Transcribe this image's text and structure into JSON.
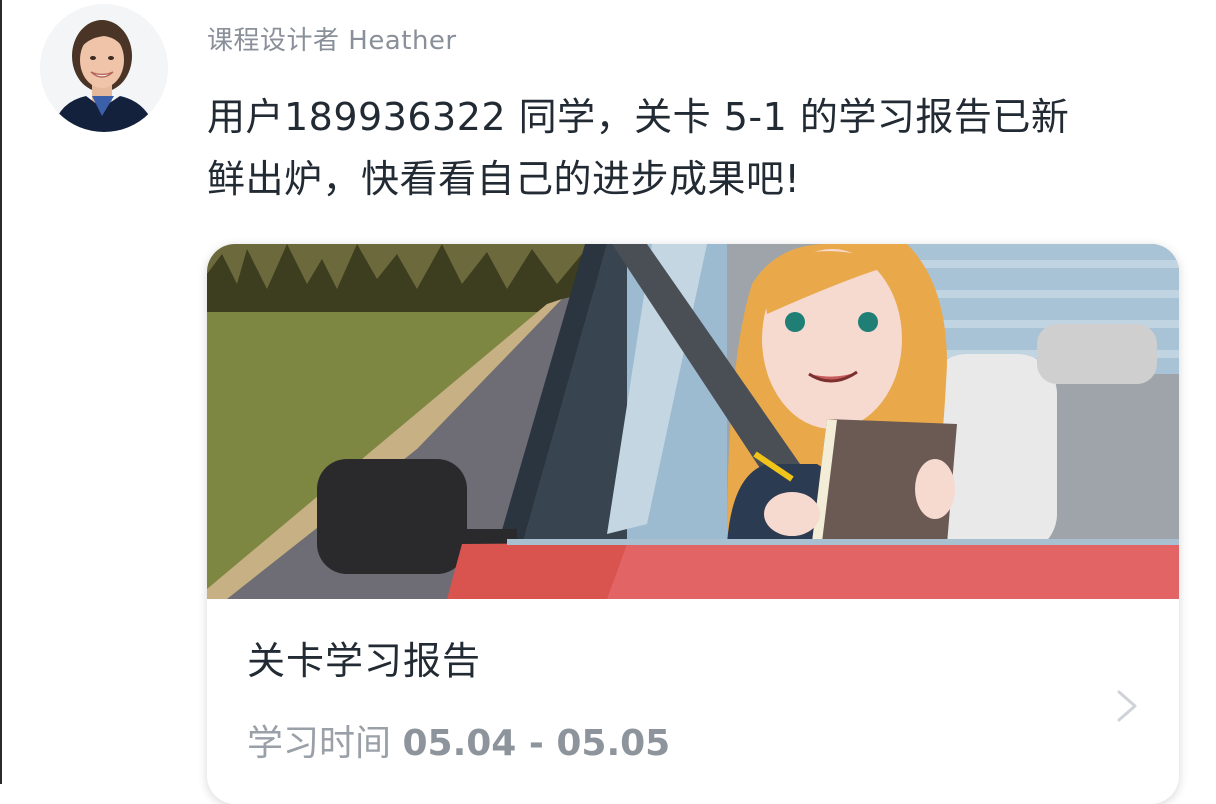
{
  "chat": {
    "sender": "课程设计者 Heather",
    "message": "用户189936322 同学，关卡 5-1 的学习报告已新\n鲜出炉，快看看自己的进步成果吧!",
    "avatar_icon": "designer-avatar"
  },
  "report_card": {
    "title": "关卡学习报告",
    "time_label": "学习时间",
    "time_range": "05.04 - 05.05",
    "image_icon": "driving-student-illustration",
    "arrow_icon": "chevron-right-icon"
  }
}
